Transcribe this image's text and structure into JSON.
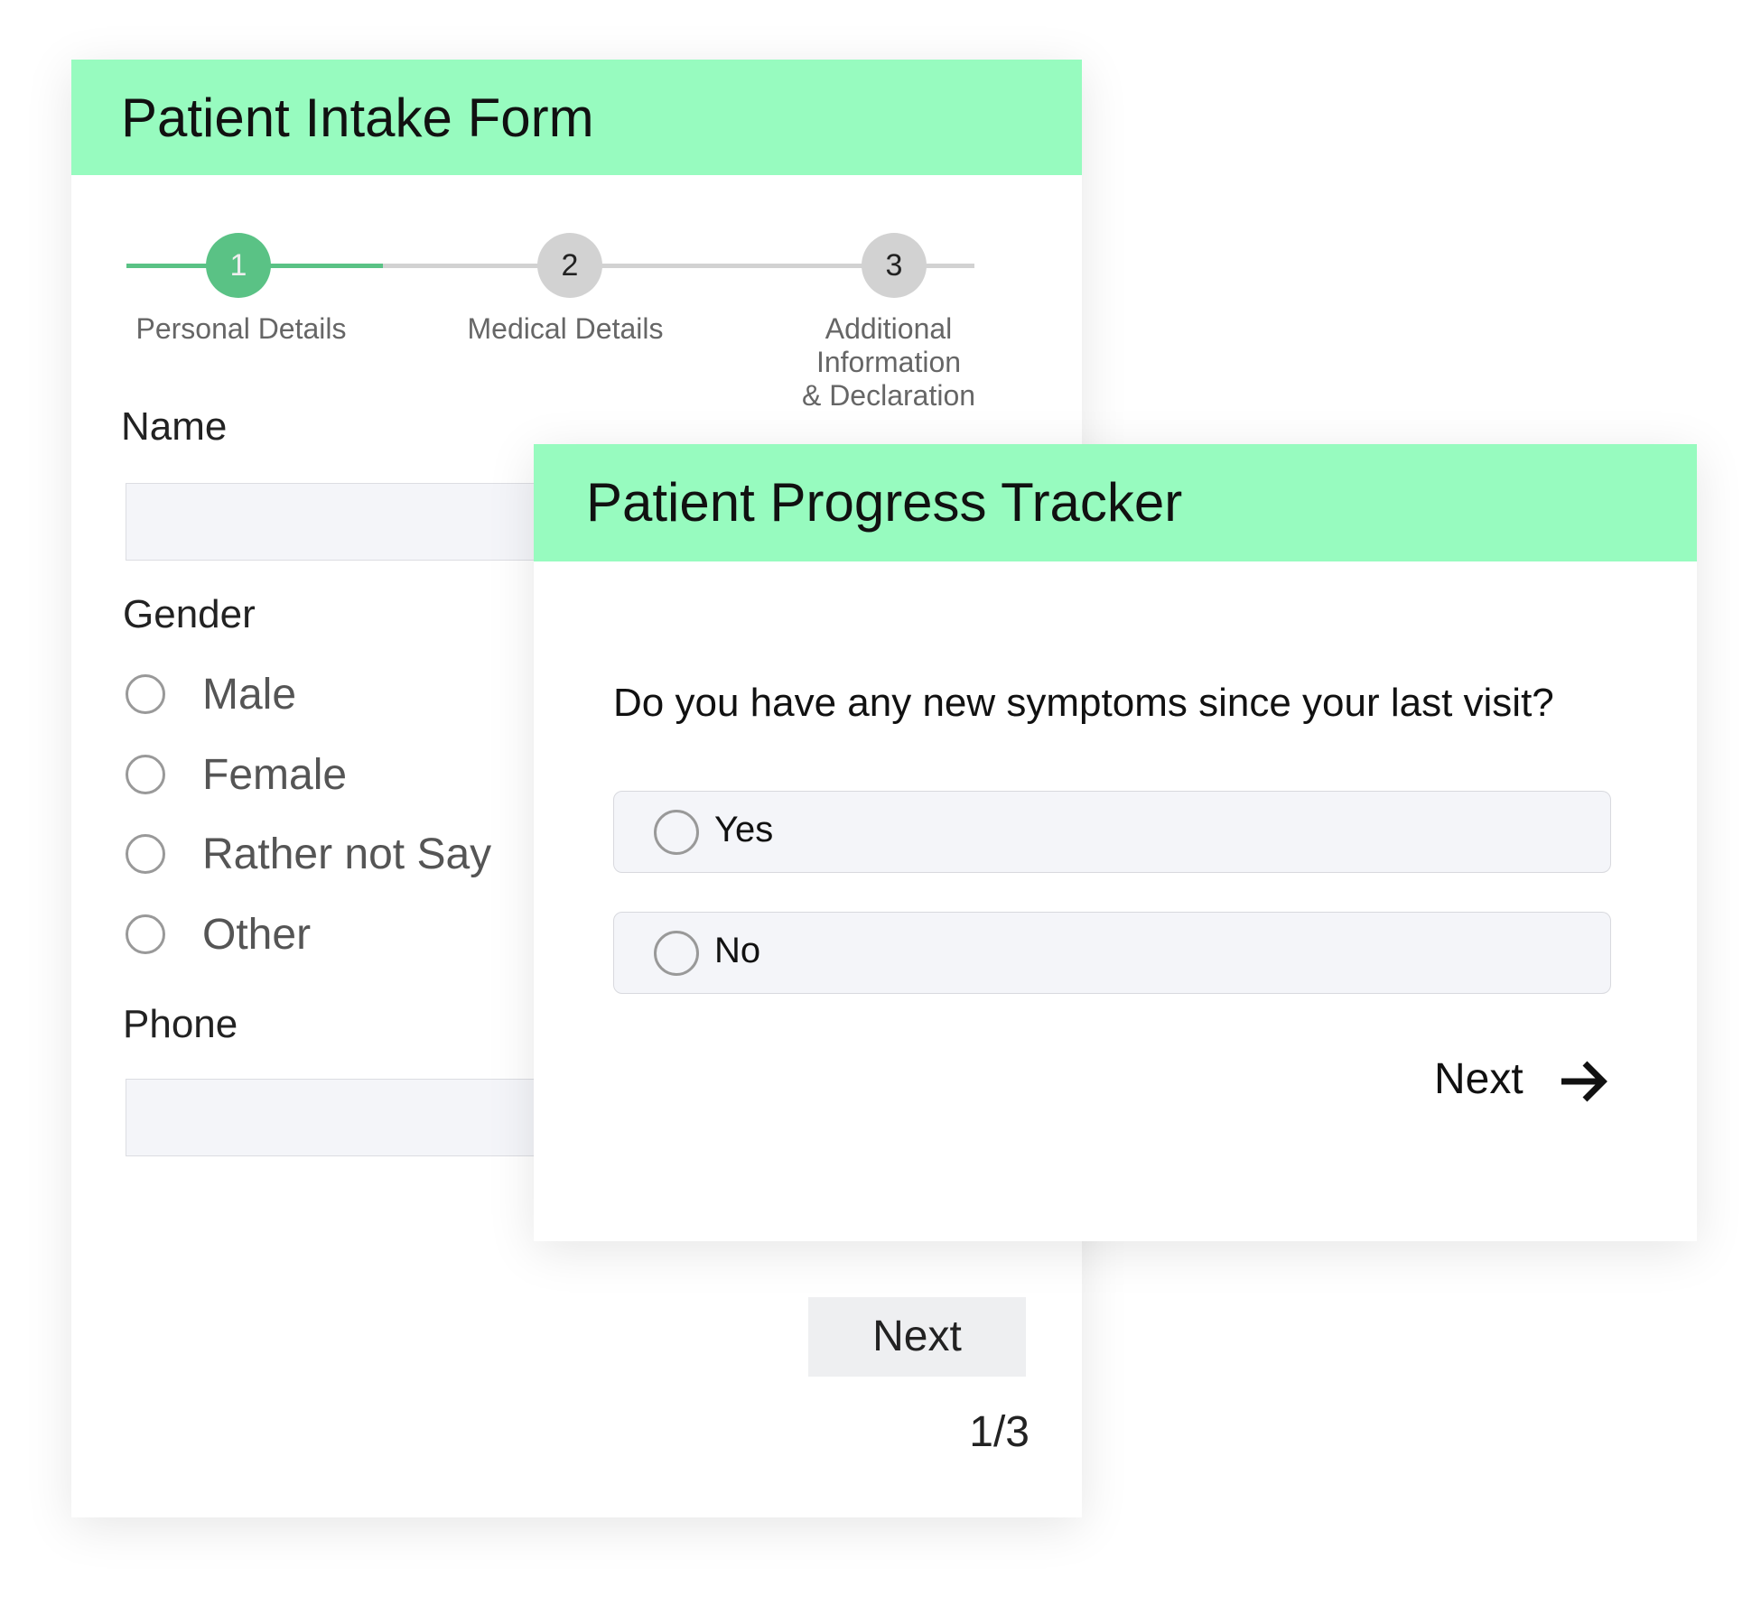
{
  "intake_form": {
    "title": "Patient Intake Form",
    "steps": [
      {
        "number": "1",
        "label": "Personal Details",
        "active": true
      },
      {
        "number": "2",
        "label": "Medical Details",
        "active": false
      },
      {
        "number": "3",
        "label_line1": "Additional Information",
        "label_line2": "& Declaration",
        "active": false
      }
    ],
    "name_label": "Name",
    "name_value": "",
    "gender_label": "Gender",
    "gender_options": [
      "Male",
      "Female",
      "Rather not Say",
      "Other"
    ],
    "phone_label": "Phone",
    "phone_value": "",
    "next_label": "Next",
    "page_indicator": "1/3",
    "progress_fraction": 0.33
  },
  "progress_tracker": {
    "title": "Patient Progress Tracker",
    "question": "Do you have any new symptoms since your last visit?",
    "options": [
      "Yes",
      "No"
    ],
    "next_label": "Next",
    "next_icon": "arrow-right-icon"
  },
  "colors": {
    "header": "#97fbbf",
    "accent": "#5ac285",
    "inactive": "#d2d2d2"
  }
}
